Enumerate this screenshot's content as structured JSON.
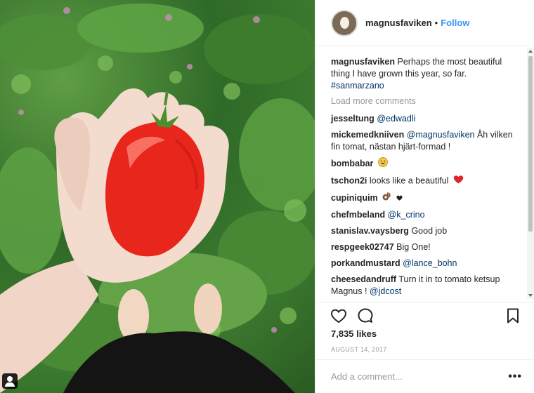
{
  "post": {
    "owner": "magnusfaviken",
    "separator": "•",
    "follow_label": "Follow",
    "caption": {
      "user": "magnusfaviken",
      "text": "Perhaps the most beautiful thing I have grown this year, so far.",
      "hashtag": "#sanmarzano"
    },
    "load_more": "Load more comments",
    "comments": [
      {
        "user": "jesseltung",
        "text": "",
        "mention": "@edwadli"
      },
      {
        "user": "mickemedkniiven",
        "text": "",
        "mention": "@magnusfaviken",
        "after": "Åh vilken fin tomat, nästan hjärt-formad !"
      },
      {
        "user": "bombabar",
        "text": "",
        "emoji": "grinning-face"
      },
      {
        "user": "tschon2i",
        "text": "looks like a beautiful",
        "emoji": "red-heart"
      },
      {
        "user": "cupiniquim",
        "text": "",
        "emoji": "ok-hand-heart"
      },
      {
        "user": "chefmbeland",
        "text": "",
        "mention": "@k_crino"
      },
      {
        "user": "stanislav.vaysberg",
        "text": "Good job"
      },
      {
        "user": "respgeek02747",
        "text": "Big One!"
      },
      {
        "user": "porkandmustard",
        "text": "",
        "mention": "@lance_bohn"
      },
      {
        "user": "cheesedandruff",
        "text": "Turn it in to tomato ketsup Magnus !",
        "mention": "@jdcost"
      }
    ],
    "likes": "7,835 likes",
    "date": "AUGUST 14, 2017",
    "add_comment_placeholder": "Add a comment...",
    "more_label": "•••"
  },
  "colors": {
    "accent": "#3897f0",
    "mention": "#003569",
    "muted": "#999999",
    "tomato": "#e8261c"
  },
  "icons": [
    "tag-user-icon",
    "heart-icon",
    "comment-icon",
    "bookmark-icon",
    "more-options-icon"
  ]
}
